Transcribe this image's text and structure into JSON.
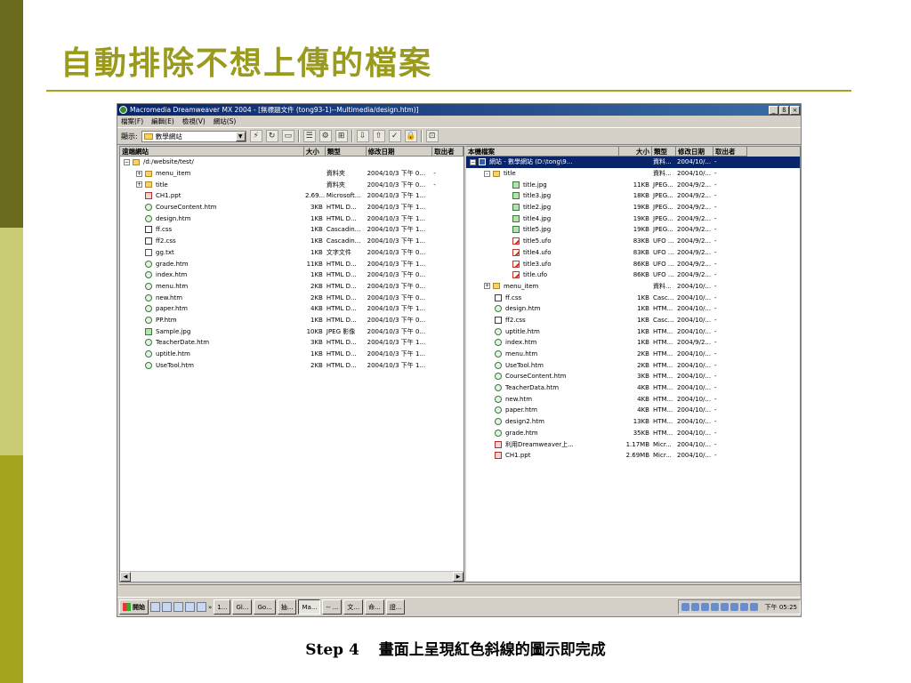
{
  "slide": {
    "title": "自動排除不想上傳的檔案",
    "caption_step": "Step 4",
    "caption_text": "畫面上呈現紅色斜線的圖示即完成"
  },
  "window": {
    "title": "Macromedia Dreamweaver MX 2004 - [無標題文件 (tong93-1)--Multimedia/design.htm)]",
    "buttons": [
      "_",
      "ß",
      "×"
    ]
  },
  "menu": [
    "檔案(F)",
    "編輯(E)",
    "檢視(V)",
    "網站(S)"
  ],
  "toolbar": {
    "show_label": "顯示:",
    "site_value": "數學網站"
  },
  "remote": {
    "columns": [
      "遠端網站",
      "大小",
      "類型",
      "修改日期",
      "取出者"
    ],
    "root": "/d:/website/test/",
    "items": [
      {
        "name": "menu_item",
        "size": "",
        "type": "資料夾",
        "date": "2004/10/3 下午 0...",
        "by": "-",
        "icon": "folder",
        "expand": "+"
      },
      {
        "name": "title",
        "size": "",
        "type": "資料夾",
        "date": "2004/10/3 下午 0...",
        "by": "-",
        "icon": "folder",
        "expand": "+"
      },
      {
        "name": "CH1.ppt",
        "size": "2.69...",
        "type": "Microsoft...",
        "date": "2004/10/3 下午 1...",
        "by": "",
        "icon": "ppt"
      },
      {
        "name": "CourseContent.htm",
        "size": "3KB",
        "type": "HTML D...",
        "date": "2004/10/3 下午 1...",
        "by": "",
        "icon": "html"
      },
      {
        "name": "design.htm",
        "size": "1KB",
        "type": "HTML D...",
        "date": "2004/10/3 下午 1...",
        "by": "",
        "icon": "html"
      },
      {
        "name": "ff.css",
        "size": "1KB",
        "type": "Cascadin...",
        "date": "2004/10/3 下午 1...",
        "by": "",
        "icon": "css"
      },
      {
        "name": "ff2.css",
        "size": "1KB",
        "type": "Cascadin...",
        "date": "2004/10/3 下午 1...",
        "by": "",
        "icon": "css"
      },
      {
        "name": "gg.txt",
        "size": "1KB",
        "type": "文字文件",
        "date": "2004/10/3 下午 0...",
        "by": "",
        "icon": "txt"
      },
      {
        "name": "grade.htm",
        "size": "11KB",
        "type": "HTML D...",
        "date": "2004/10/3 下午 1...",
        "by": "",
        "icon": "html"
      },
      {
        "name": "index.htm",
        "size": "1KB",
        "type": "HTML D...",
        "date": "2004/10/3 下午 0...",
        "by": "",
        "icon": "html"
      },
      {
        "name": "menu.htm",
        "size": "2KB",
        "type": "HTML D...",
        "date": "2004/10/3 下午 0...",
        "by": "",
        "icon": "html"
      },
      {
        "name": "new.htm",
        "size": "2KB",
        "type": "HTML D...",
        "date": "2004/10/3 下午 0...",
        "by": "",
        "icon": "html"
      },
      {
        "name": "paper.htm",
        "size": "4KB",
        "type": "HTML D...",
        "date": "2004/10/3 下午 1...",
        "by": "",
        "icon": "html"
      },
      {
        "name": "PP.htm",
        "size": "1KB",
        "type": "HTML D...",
        "date": "2004/10/3 下午 0...",
        "by": "",
        "icon": "html"
      },
      {
        "name": "Sample.jpg",
        "size": "10KB",
        "type": "JPEG 影像",
        "date": "2004/10/3 下午 0...",
        "by": "",
        "icon": "jpg"
      },
      {
        "name": "TeacherDate.htm",
        "size": "3KB",
        "type": "HTML D...",
        "date": "2004/10/3 下午 1...",
        "by": "",
        "icon": "html"
      },
      {
        "name": "uptitle.htm",
        "size": "1KB",
        "type": "HTML D...",
        "date": "2004/10/3 下午 1...",
        "by": "",
        "icon": "html"
      },
      {
        "name": "UseTool.htm",
        "size": "2KB",
        "type": "HTML D...",
        "date": "2004/10/3 下午 1...",
        "by": "",
        "icon": "html"
      }
    ]
  },
  "local": {
    "columns": [
      "本機檔案",
      "大小",
      "類型",
      "修改日期",
      "取出者"
    ],
    "root": {
      "name": "網站 - 數學網站 (D:\\tong\\9...",
      "size": "",
      "type": "資料...",
      "date": "2004/10/...",
      "by": "-"
    },
    "items": [
      {
        "name": "title",
        "size": "",
        "type": "資料...",
        "date": "2004/10/...",
        "by": "-",
        "icon": "folder",
        "level": 1,
        "expand": "-"
      },
      {
        "name": "title.jpg",
        "size": "11KB",
        "type": "JPEG...",
        "date": "2004/9/2...",
        "by": "-",
        "icon": "jpg",
        "level": 2
      },
      {
        "name": "title3.jpg",
        "size": "18KB",
        "type": "JPEG...",
        "date": "2004/9/2...",
        "by": "-",
        "icon": "jpg",
        "level": 2
      },
      {
        "name": "title2.jpg",
        "size": "19KB",
        "type": "JPEG...",
        "date": "2004/9/2...",
        "by": "-",
        "icon": "jpg",
        "level": 2
      },
      {
        "name": "title4.jpg",
        "size": "19KB",
        "type": "JPEG...",
        "date": "2004/9/2...",
        "by": "-",
        "icon": "jpg",
        "level": 2
      },
      {
        "name": "title5.jpg",
        "size": "19KB",
        "type": "JPEG...",
        "date": "2004/9/2...",
        "by": "-",
        "icon": "jpg",
        "level": 2
      },
      {
        "name": "title5.ufo",
        "size": "83KB",
        "type": "UFO ...",
        "date": "2004/9/2...",
        "by": "-",
        "icon": "ufo",
        "level": 2
      },
      {
        "name": "title4.ufo",
        "size": "83KB",
        "type": "UFO ...",
        "date": "2004/9/2...",
        "by": "-",
        "icon": "ufo",
        "level": 2
      },
      {
        "name": "title3.ufo",
        "size": "86KB",
        "type": "UFO ...",
        "date": "2004/9/2...",
        "by": "-",
        "icon": "ufo",
        "level": 2
      },
      {
        "name": "title.ufo",
        "size": "86KB",
        "type": "UFO ...",
        "date": "2004/9/2...",
        "by": "-",
        "icon": "ufo",
        "level": 2
      },
      {
        "name": "menu_item",
        "size": "",
        "type": "資料...",
        "date": "2004/10/...",
        "by": "-",
        "icon": "folder",
        "level": 1,
        "expand": "+"
      },
      {
        "name": "ff.css",
        "size": "1KB",
        "type": "Casc...",
        "date": "2004/10/...",
        "by": "-",
        "icon": "css",
        "level": 1
      },
      {
        "name": "design.htm",
        "size": "1KB",
        "type": "HTM...",
        "date": "2004/10/...",
        "by": "-",
        "icon": "html",
        "level": 1
      },
      {
        "name": "ff2.css",
        "size": "1KB",
        "type": "Casc...",
        "date": "2004/10/...",
        "by": "-",
        "icon": "css",
        "level": 1
      },
      {
        "name": "uptitle.htm",
        "size": "1KB",
        "type": "HTM...",
        "date": "2004/10/...",
        "by": "-",
        "icon": "html",
        "level": 1
      },
      {
        "name": "index.htm",
        "size": "1KB",
        "type": "HTM...",
        "date": "2004/9/2...",
        "by": "-",
        "icon": "html",
        "level": 1
      },
      {
        "name": "menu.htm",
        "size": "2KB",
        "type": "HTM...",
        "date": "2004/10/...",
        "by": "-",
        "icon": "html",
        "level": 1
      },
      {
        "name": "UseTool.htm",
        "size": "2KB",
        "type": "HTM...",
        "date": "2004/10/...",
        "by": "-",
        "icon": "html",
        "level": 1
      },
      {
        "name": "CourseContent.htm",
        "size": "3KB",
        "type": "HTM...",
        "date": "2004/10/...",
        "by": "-",
        "icon": "html",
        "level": 1
      },
      {
        "name": "TeacherData.htm",
        "size": "4KB",
        "type": "HTM...",
        "date": "2004/10/...",
        "by": "-",
        "icon": "html",
        "level": 1
      },
      {
        "name": "new.htm",
        "size": "4KB",
        "type": "HTM...",
        "date": "2004/10/...",
        "by": "-",
        "icon": "html",
        "level": 1
      },
      {
        "name": "paper.htm",
        "size": "4KB",
        "type": "HTM...",
        "date": "2004/10/...",
        "by": "-",
        "icon": "html",
        "level": 1
      },
      {
        "name": "design2.htm",
        "size": "13KB",
        "type": "HTM...",
        "date": "2004/10/...",
        "by": "-",
        "icon": "html",
        "level": 1
      },
      {
        "name": "grade.htm",
        "size": "35KB",
        "type": "HTM...",
        "date": "2004/10/...",
        "by": "-",
        "icon": "html",
        "level": 1
      },
      {
        "name": "利用Dreamweaver上...",
        "size": "1.17MB",
        "type": "Micr...",
        "date": "2004/10/...",
        "by": "-",
        "icon": "ppt",
        "level": 1
      },
      {
        "name": "CH1.ppt",
        "size": "2.69MB",
        "type": "Micr...",
        "date": "2004/10/...",
        "by": "-",
        "icon": "ppt",
        "level": 1
      }
    ]
  },
  "taskbar": {
    "start_label": "開始",
    "chevron": "»",
    "tasks": [
      "1...",
      "Gl...",
      "Go...",
      "抽...",
      "Ma...",
      "-- ...",
      "文...",
      "命...",
      "證..."
    ],
    "active_task": 4,
    "clock": "下午 05:25"
  },
  "colors": {
    "accent_olive": "#9a9a1c",
    "title_bar": "#0a246a",
    "slash_red": "#d22222"
  }
}
